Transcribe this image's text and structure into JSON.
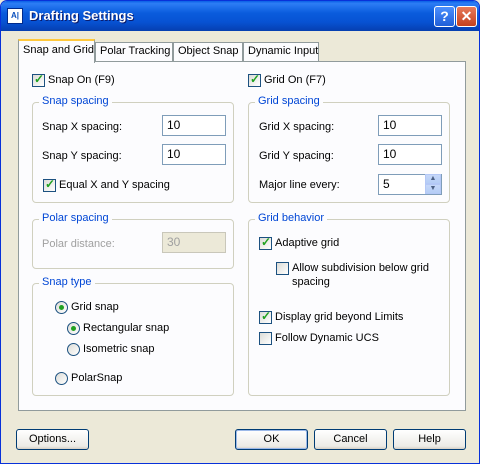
{
  "window": {
    "title": "Drafting Settings",
    "help_glyph": "?",
    "close_glyph": "✕",
    "icon_text": "A|"
  },
  "tabs": [
    {
      "label": "Snap and Grid",
      "active": true
    },
    {
      "label": "Polar Tracking"
    },
    {
      "label": "Object Snap"
    },
    {
      "label": "Dynamic Input"
    }
  ],
  "snap_on": {
    "label": "Snap On (F9)",
    "checked": true
  },
  "grid_on": {
    "label": "Grid On (F7)",
    "checked": true
  },
  "snap_spacing": {
    "title": "Snap spacing",
    "x_label": "Snap X spacing:",
    "x_value": "10",
    "y_label": "Snap Y spacing:",
    "y_value": "10",
    "equal_label": "Equal X and Y spacing",
    "equal_checked": true
  },
  "grid_spacing": {
    "title": "Grid spacing",
    "x_label": "Grid X spacing:",
    "x_value": "10",
    "y_label": "Grid Y spacing:",
    "y_value": "10",
    "major_label": "Major line every:",
    "major_value": "5"
  },
  "polar_spacing": {
    "title": "Polar spacing",
    "distance_label": "Polar distance:",
    "distance_value": "30"
  },
  "snap_type": {
    "title": "Snap type",
    "grid_snap": "Grid snap",
    "rectangular": "Rectangular snap",
    "isometric": "Isometric snap",
    "polar": "PolarSnap"
  },
  "grid_behavior": {
    "title": "Grid behavior",
    "adaptive": "Adaptive grid",
    "subdivision_line1": "Allow subdivision below grid",
    "subdivision_line2": "spacing",
    "beyond_limits": "Display grid beyond Limits",
    "follow_ucs": "Follow Dynamic UCS"
  },
  "buttons": {
    "options": "Options...",
    "ok": "OK",
    "cancel": "Cancel",
    "help": "Help"
  },
  "colors": {
    "title_blue": "#0a5cdd",
    "group_title": "#0046d5",
    "check_green": "#21a121"
  }
}
